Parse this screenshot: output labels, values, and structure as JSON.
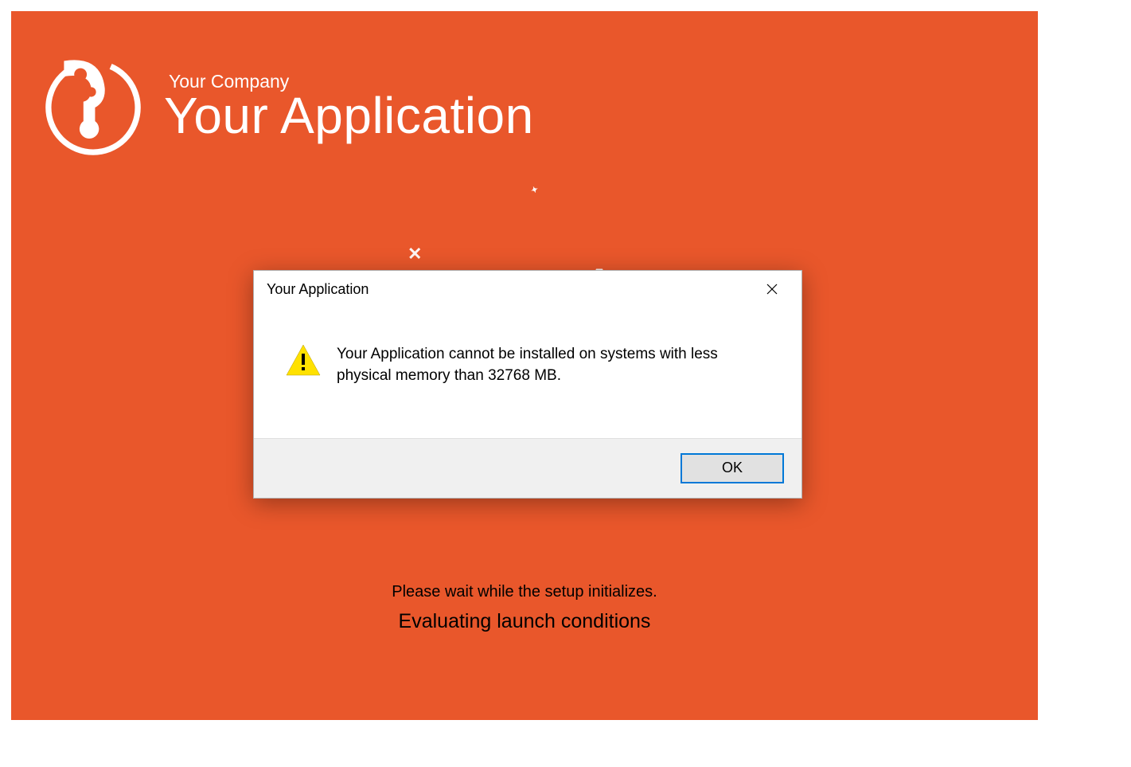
{
  "header": {
    "company": "Your Company",
    "application": "Your Application"
  },
  "progress": {
    "wait_message": "Please wait while the setup initializes.",
    "status": "Evaluating launch conditions"
  },
  "dialog": {
    "title": "Your Application",
    "message": "Your Application cannot be installed on systems with less physical memory than 32768 MB.",
    "ok_label": "OK"
  },
  "colors": {
    "brand": "#e9572b",
    "accent_button_border": "#0078d7"
  }
}
